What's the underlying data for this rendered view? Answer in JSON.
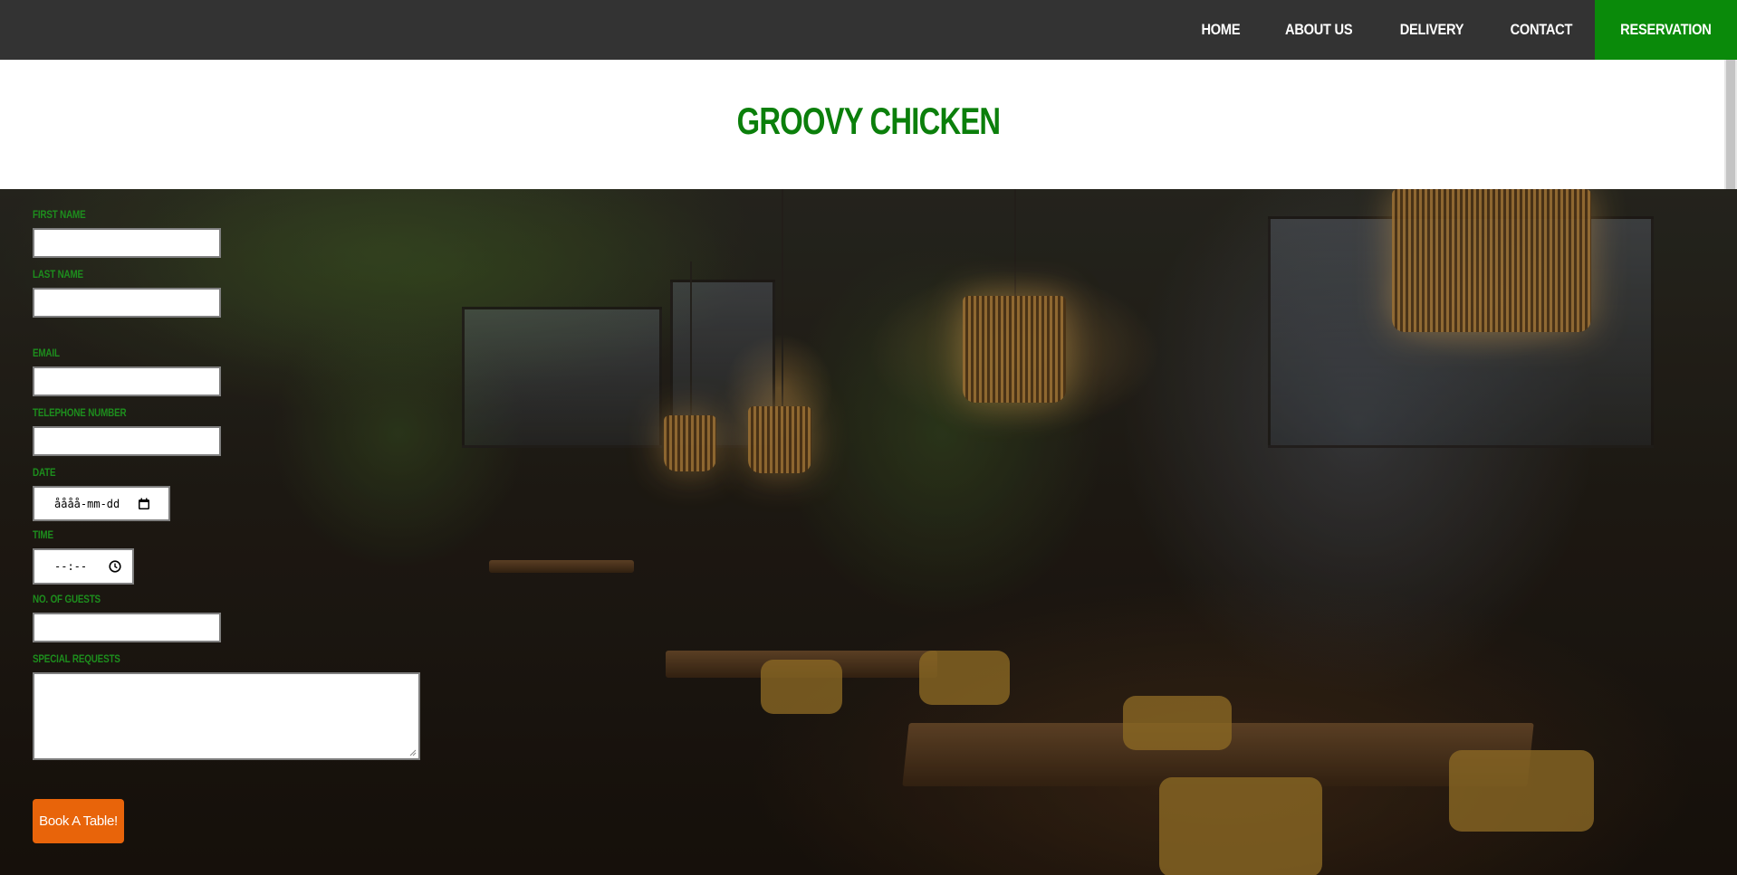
{
  "nav": {
    "items": [
      {
        "label": "HOME"
      },
      {
        "label": "ABOUT US"
      },
      {
        "label": "DELIVERY"
      },
      {
        "label": "CONTACT"
      },
      {
        "label": "RESERVATION",
        "active": true
      }
    ]
  },
  "header": {
    "title": "GROOVY CHICKEN"
  },
  "form": {
    "first_name_label": "FIRST NAME",
    "last_name_label": "LAST NAME",
    "email_label": "EMAIL",
    "telephone_label": "TELEPHONE NUMBER",
    "date_label": "DATE",
    "date_value": "åååå-mm-dd",
    "time_label": "TIME",
    "time_value": "--:--",
    "guests_label": "NO. OF GUESTS",
    "requests_label": "SPECIAL REQUESTS",
    "submit_label": "Book A Table!"
  },
  "colors": {
    "nav_bg": "#333333",
    "accent_green": "#0a8a0a",
    "title_green": "#0b7f0b",
    "button_orange": "#e8640a"
  },
  "icons": {
    "date_picker": "calendar-icon",
    "time_picker": "clock-icon"
  }
}
